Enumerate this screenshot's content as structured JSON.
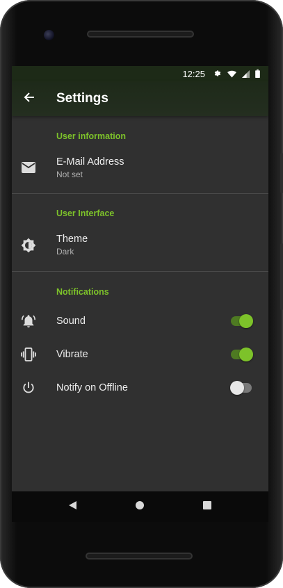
{
  "status_bar": {
    "time": "12:25",
    "icons": [
      "gear-icon",
      "wifi-icon",
      "signal-icon",
      "battery-icon"
    ]
  },
  "app_bar": {
    "title": "Settings",
    "back_icon": "arrow-left-icon"
  },
  "sections": [
    {
      "header": "User information",
      "items": [
        {
          "title": "E-Mail Address",
          "summary": "Not set",
          "icon": "email-icon"
        }
      ]
    },
    {
      "header": "User Interface",
      "items": [
        {
          "title": "Theme",
          "summary": "Dark",
          "icon": "brightness-icon"
        }
      ]
    },
    {
      "header": "Notifications",
      "items": [
        {
          "title": "Sound",
          "icon": "bell-ring-icon",
          "switch_on": true
        },
        {
          "title": "Vibrate",
          "icon": "vibration-icon",
          "switch_on": true
        },
        {
          "title": "Notify on Offline",
          "icon": "power-icon",
          "switch_on": false
        }
      ]
    }
  ],
  "nav_bar": {
    "icons": [
      "back-triangle-icon",
      "home-circle-icon",
      "recents-square-icon"
    ]
  },
  "colors": {
    "accent": "#7dc22a",
    "background": "#303030",
    "app_bar": "#242e20",
    "text_primary": "#eeeeee",
    "text_secondary": "#b0b0b0"
  }
}
